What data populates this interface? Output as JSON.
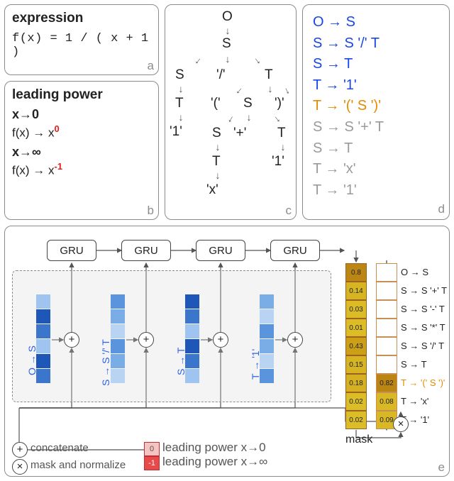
{
  "panels": {
    "a": {
      "title": "expression",
      "expr": "f(x) = 1 / ( x + 1 )",
      "label": "a"
    },
    "b": {
      "title": "leading power",
      "lim0": "x→0",
      "line0_pre": "f(x) → x",
      "line0_exp": "0",
      "liminf": "x→∞",
      "lineinf_pre": "f(x) → x",
      "lineinf_exp": "-1",
      "label": "b"
    },
    "c": {
      "label": "c",
      "nodes": {
        "O": "O",
        "S1": "S",
        "S2": "S",
        "slash": "'/'",
        "T1": "T",
        "T2": "T",
        "lp": "'('",
        "S3": "S",
        "rp": "')'",
        "one1": "'1'",
        "S4": "S",
        "plus": "'+'",
        "T3": "T",
        "T4": "T",
        "one2": "'1'",
        "x": "'x'"
      }
    },
    "d": {
      "label": "d",
      "rules": [
        {
          "t": "O → S",
          "c": "blue"
        },
        {
          "t": "S → S '/' T",
          "c": "blue"
        },
        {
          "t": "S → T",
          "c": "blue"
        },
        {
          "t": "T → '1'",
          "c": "blue"
        },
        {
          "t": "T → '(' S ')'",
          "c": "orange"
        },
        {
          "t": "S → S '+' T",
          "c": "gray"
        },
        {
          "t": "S → T",
          "c": "gray"
        },
        {
          "t": "T → 'x'",
          "c": "gray"
        },
        {
          "t": "T → '1'",
          "c": "gray"
        }
      ]
    },
    "e": {
      "label": "e",
      "gru": "GRU",
      "step_labels": [
        "O → S",
        "S → S '/' T",
        "S → T",
        "T → '1'"
      ],
      "bars_left": [
        "0.8",
        "0.14",
        "0.03",
        "0.01",
        "0.43",
        "0.15",
        "0.18",
        "0.02",
        "0.02"
      ],
      "bars_right": [
        "",
        "",
        "",
        "",
        "",
        "",
        "0.82",
        "0.08",
        "0.09"
      ],
      "rule_list": [
        "O → S",
        "S → S '+' T",
        "S → S '-' T",
        "S → S '*' T",
        "S → S '/' T",
        "S → T",
        "T → '(' S ')'",
        "T → 'x'",
        "T → '1'"
      ],
      "rule_colors": [
        "",
        "",
        "",
        "",
        "",
        "",
        "orange",
        "",
        ""
      ],
      "mask": "mask",
      "red0": "0",
      "redinf": "-1",
      "concat": "concatenate",
      "maskn": "mask and normalize",
      "lp0": "leading power x→0",
      "lpinf": "leading power x→∞"
    }
  }
}
